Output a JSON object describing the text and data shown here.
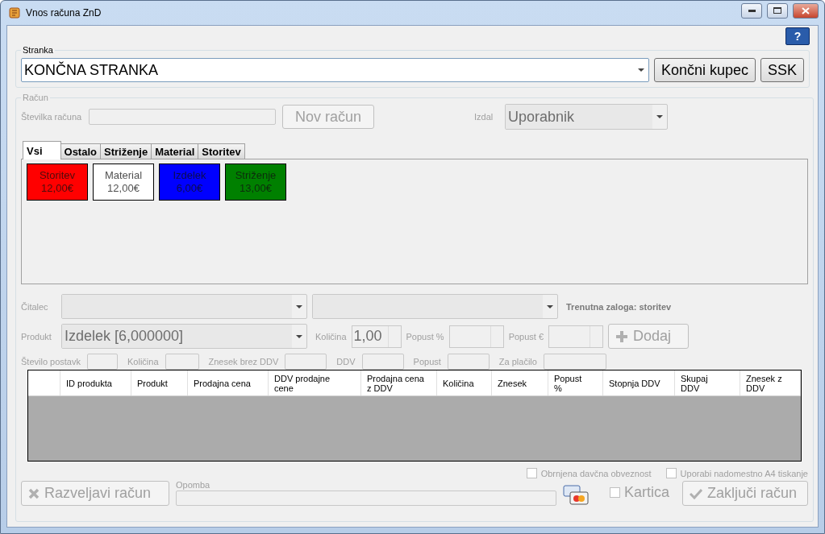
{
  "window": {
    "title": "Vnos računa ZnD"
  },
  "help_button": "?",
  "customer": {
    "group_label": "Stranka",
    "value": "KONČNA STRANKA",
    "buttons": [
      "Končni kupec",
      "SSK"
    ]
  },
  "invoice": {
    "group_label": "Račun",
    "disabled": true,
    "number_label": "Številka računa",
    "new_button": "Nov račun",
    "issued_by_label": "Izdal",
    "issued_by_value": "Uporabnik",
    "tabs": [
      {
        "label": "Vsi",
        "selected": true
      },
      {
        "label": "Ostalo",
        "selected": false
      },
      {
        "label": "Striženje",
        "selected": false
      },
      {
        "label": "Material",
        "selected": false
      },
      {
        "label": "Storitev",
        "selected": false
      }
    ],
    "tiles": [
      {
        "name": "Storitev",
        "price": "12,00€",
        "color": "#ff0000"
      },
      {
        "name": "Material",
        "price": "12,00€",
        "color": "#ffffff"
      },
      {
        "name": "Izdelek",
        "price": "6,00€",
        "color": "#0000ff"
      },
      {
        "name": "Striženje",
        "price": "13,00€",
        "color": "#008000"
      }
    ],
    "reader_label": "Čitalec",
    "stock_label": "Trenutna zaloga: storitev",
    "product_label": "Produkt",
    "product_value": "Izdelek [6,000000]",
    "quantity_label": "Količina",
    "quantity_value": "1,00",
    "discount_pct_label": "Popust %",
    "discount_eur_label": "Popust €",
    "add_button": "Dodaj",
    "totals": [
      "Število postavk",
      "Količina",
      "Znesek brez DDV",
      "DDV",
      "Popust",
      "Za plačilo"
    ],
    "table": {
      "columns": [
        "ID produkta",
        "Produkt",
        "Prodajna cena",
        "DDV prodajne cene",
        "Prodajna cena z DDV",
        "Količina",
        "Znesek",
        "Popust %",
        "Stopnja DDV",
        "Skupaj DDV",
        "Znesek z DDV"
      ]
    },
    "options": [
      {
        "label": "Obrnjena davčna obveznost",
        "checked": false
      },
      {
        "label": "Uporabi nadomestno A4 tiskanje",
        "checked": false
      }
    ],
    "cancel_button": "Razveljavi račun",
    "note_label": "Opomba",
    "card": {
      "label": "Kartica",
      "checked": false
    },
    "close_button": "Zaključi račun"
  }
}
